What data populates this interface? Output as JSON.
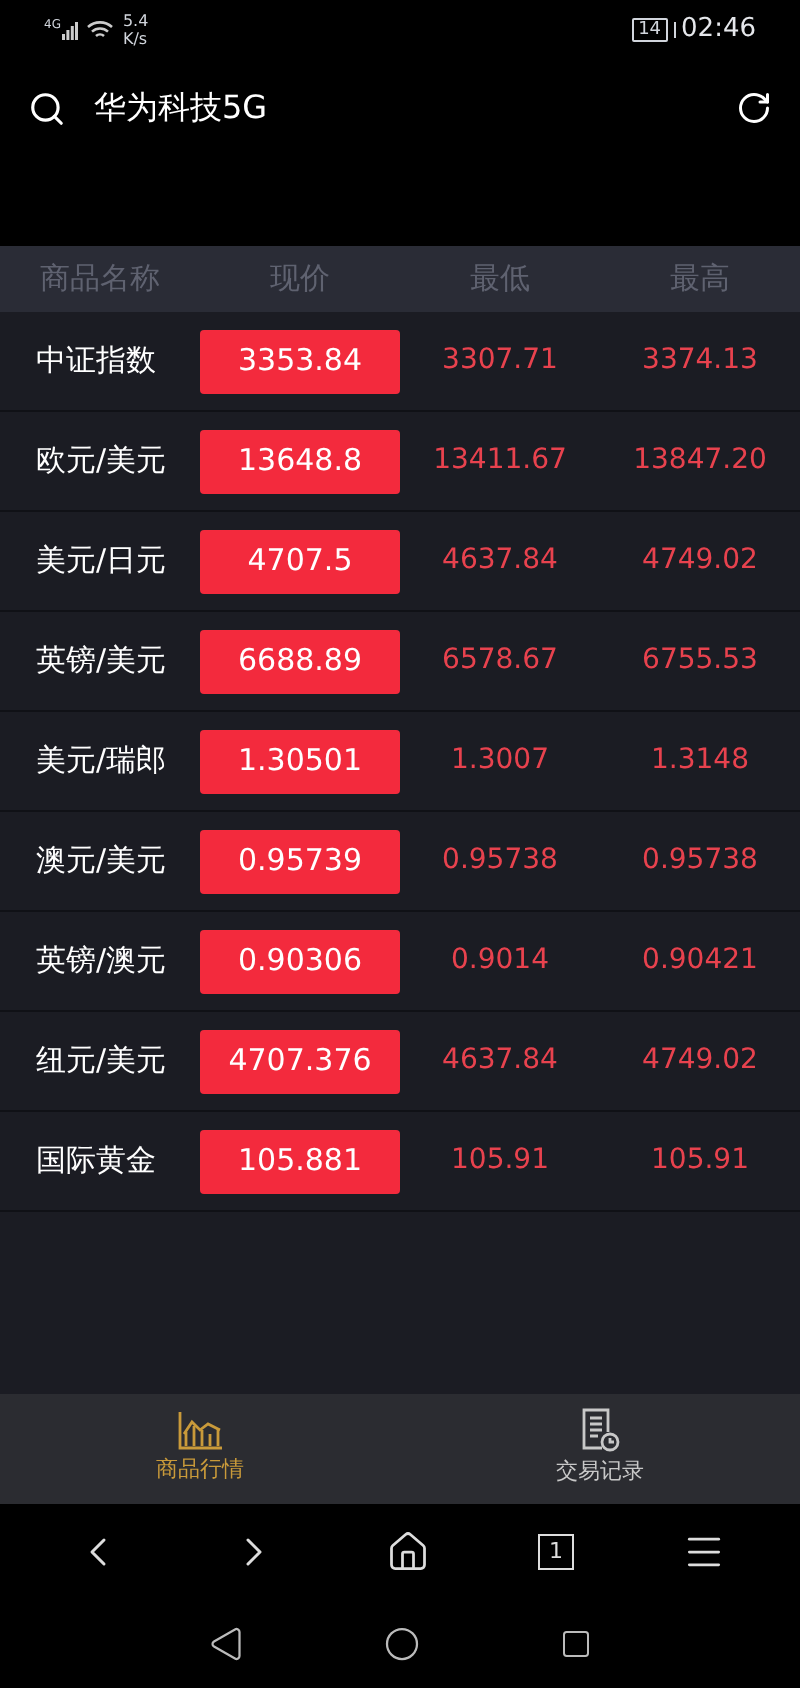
{
  "status_bar": {
    "network": "4G",
    "speed_value": "5.4",
    "speed_unit": "K/s",
    "battery": "14",
    "time": "02:46"
  },
  "header": {
    "title": "华为科技5G"
  },
  "table": {
    "columns": [
      "商品名称",
      "现价",
      "最低",
      "最高"
    ],
    "rows": [
      {
        "name": "中证指数",
        "price": "3353.84",
        "low": "3307.71",
        "high": "3374.13"
      },
      {
        "name": "欧元/美元",
        "price": "13648.8",
        "low": "13411.67",
        "high": "13847.20"
      },
      {
        "name": "美元/日元",
        "price": "4707.5",
        "low": "4637.84",
        "high": "4749.02"
      },
      {
        "name": "英镑/美元",
        "price": "6688.89",
        "low": "6578.67",
        "high": "6755.53"
      },
      {
        "name": "美元/瑞郎",
        "price": "1.30501",
        "low": "1.3007",
        "high": "1.3148"
      },
      {
        "name": "澳元/美元",
        "price": "0.95739",
        "low": "0.95738",
        "high": "0.95738"
      },
      {
        "name": "英镑/澳元",
        "price": "0.90306",
        "low": "0.9014",
        "high": "0.90421"
      },
      {
        "name": "纽元/美元",
        "price": "4707.376",
        "low": "4637.84",
        "high": "4749.02"
      },
      {
        "name": "国际黄金",
        "price": "105.881",
        "low": "105.91",
        "high": "105.91"
      }
    ]
  },
  "tabs": [
    {
      "label": "商品行情",
      "kind": "chart",
      "selected": true
    },
    {
      "label": "交易记录",
      "kind": "record",
      "selected": false
    }
  ],
  "browser_nav": {
    "tab_count": "1"
  }
}
